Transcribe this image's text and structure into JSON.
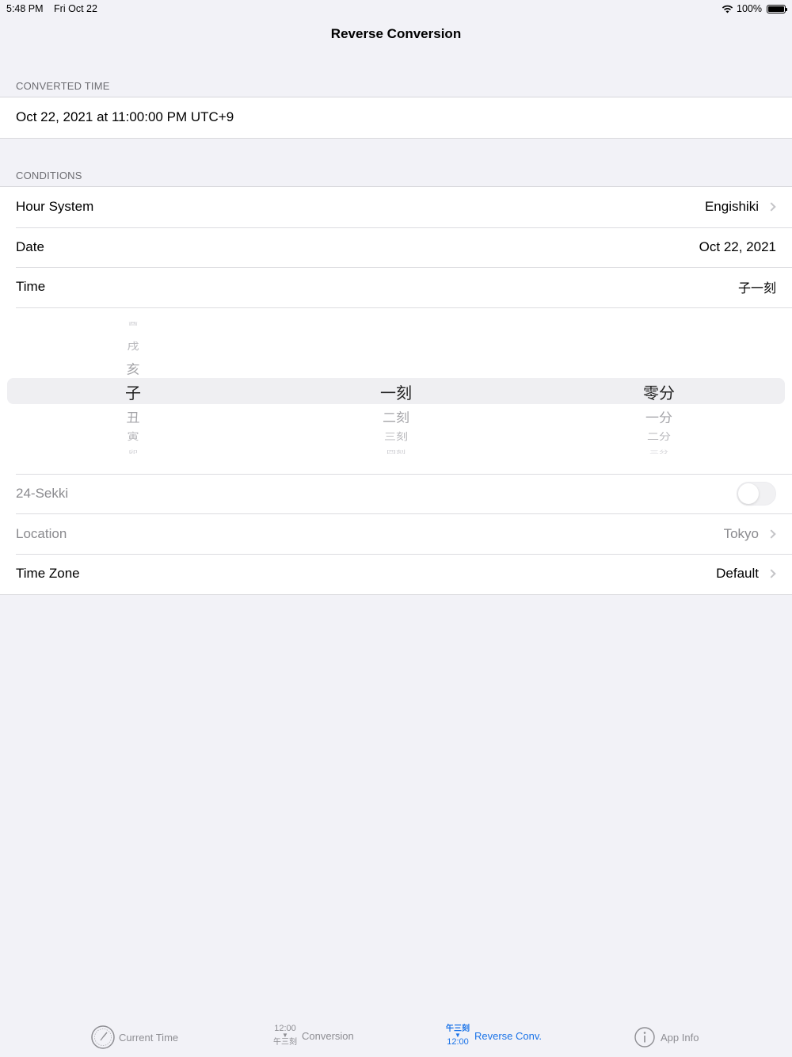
{
  "status_bar": {
    "time": "5:48 PM",
    "date": "Fri Oct 22",
    "battery": "100%"
  },
  "nav": {
    "title": "Reverse Conversion"
  },
  "converted_section": {
    "header": "CONVERTED TIME",
    "value": "Oct 22, 2021 at 11:00:00 PM UTC+9"
  },
  "conditions_section": {
    "header": "CONDITIONS",
    "hour_system": {
      "label": "Hour System",
      "value": "Engishiki"
    },
    "date": {
      "label": "Date",
      "value": "Oct 22, 2021"
    },
    "time": {
      "label": "Time",
      "value": "子一刻"
    },
    "sekki": {
      "label": "24-Sekki",
      "enabled": false
    },
    "location": {
      "label": "Location",
      "value": "Tokyo"
    },
    "timezone": {
      "label": "Time Zone",
      "value": "Default"
    }
  },
  "picker": {
    "hour": {
      "above": [
        "酉",
        "戌",
        "亥"
      ],
      "selected": "子",
      "below": [
        "丑",
        "寅",
        "卯"
      ]
    },
    "koku": {
      "above": [
        "",
        "",
        ""
      ],
      "selected": "一刻",
      "below": [
        "二刻",
        "三刻",
        "四刻"
      ]
    },
    "minute": {
      "above": [
        "",
        "",
        ""
      ],
      "selected": "零分",
      "below": [
        "一分",
        "二分",
        "三分"
      ]
    }
  },
  "tabs": [
    {
      "label": "Current Time",
      "icon": "clock-icon",
      "active": false
    },
    {
      "label": "Conversion",
      "icon": "conversion-icon",
      "icon_top": "12:00",
      "icon_bottom": "午三刻",
      "active": false
    },
    {
      "label": "Reverse Conv.",
      "icon": "reverse-conversion-icon",
      "icon_top": "午三刻",
      "icon_bottom": "12:00",
      "active": true
    },
    {
      "label": "App Info",
      "icon": "info-icon",
      "active": false
    }
  ],
  "colors": {
    "accent": "#1a73e8",
    "background": "#f2f2f7"
  }
}
